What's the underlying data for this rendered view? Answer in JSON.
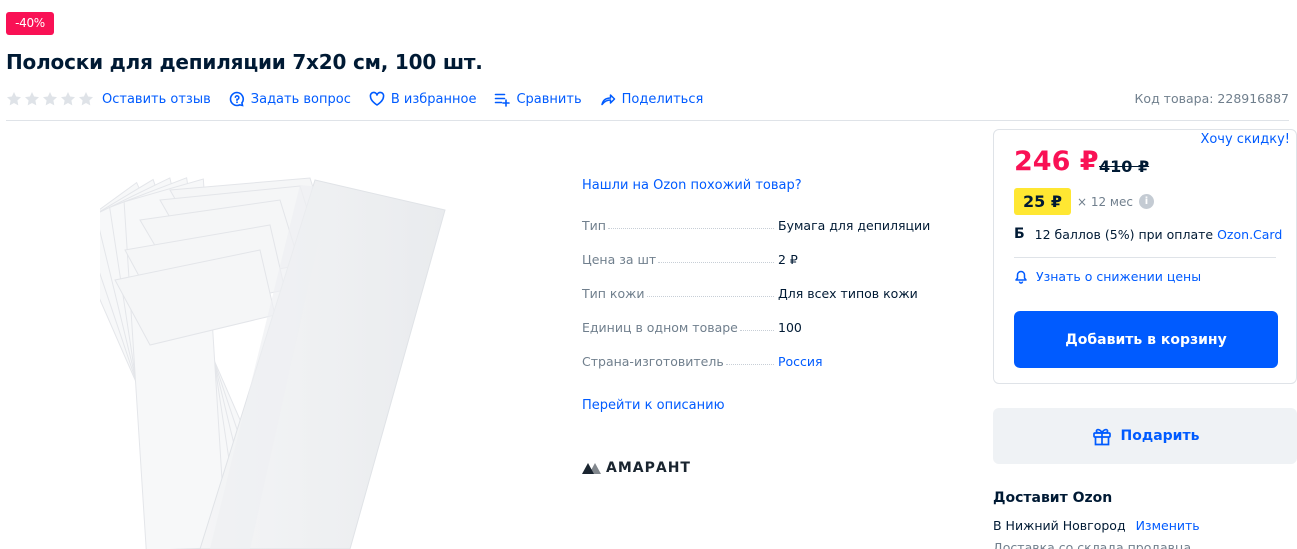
{
  "product": {
    "discount_badge": "-40%",
    "title": "Полоски для депиляции 7х20 см, 100 шт.",
    "sku_text": "Код товара: 228916887"
  },
  "actions": {
    "rating_stars_filled": 0,
    "rating_stars_total": 5,
    "leave_review": "Оставить отзыв",
    "ask_question": "Задать вопрос",
    "favorite": "В избранное",
    "compare": "Сравнить",
    "share": "Поделиться"
  },
  "specs": {
    "similar_link": "Нашли на Ozon похожий товар?",
    "rows": [
      {
        "key": "Тип",
        "value": "Бумага для депиляции"
      },
      {
        "key": "Цена за шт",
        "value": "2 ₽"
      },
      {
        "key": "Тип кожи",
        "value": "Для всех типов кожи"
      },
      {
        "key": "Единиц в одном товаре",
        "value": "100"
      },
      {
        "key": "Страна-изготовитель",
        "value": "Россия"
      }
    ],
    "to_description": "Перейти к описанию",
    "brand": "АМАРАНТ"
  },
  "price": {
    "want_discount": "Хочу скидку!",
    "current": "246 ₽",
    "old": "410 ₽",
    "installment_amount": "25 ₽",
    "installment_term": "× 12 мес",
    "bonus_icon": "Б",
    "bonus_text": "12 баллов (5%) при оплате",
    "bonus_link": "Ozon.Card",
    "notify": "Узнать о снижении цены",
    "add_to_cart": "Добавить в корзину"
  },
  "gift": {
    "label": "Подарить"
  },
  "delivery": {
    "title": "Доставит Ozon",
    "city": "В Нижний Новгород",
    "change": "Изменить",
    "subtitle": "Доставка со склада продавца"
  },
  "colors": {
    "accent": "#005bff",
    "price_red": "#f91155",
    "installment_yellow": "#ffe732"
  },
  "icons": [
    "star-icon",
    "question-icon",
    "heart-icon",
    "compare-icon",
    "share-icon",
    "bell-icon",
    "gift-icon",
    "info-icon",
    "brand-logo"
  ]
}
